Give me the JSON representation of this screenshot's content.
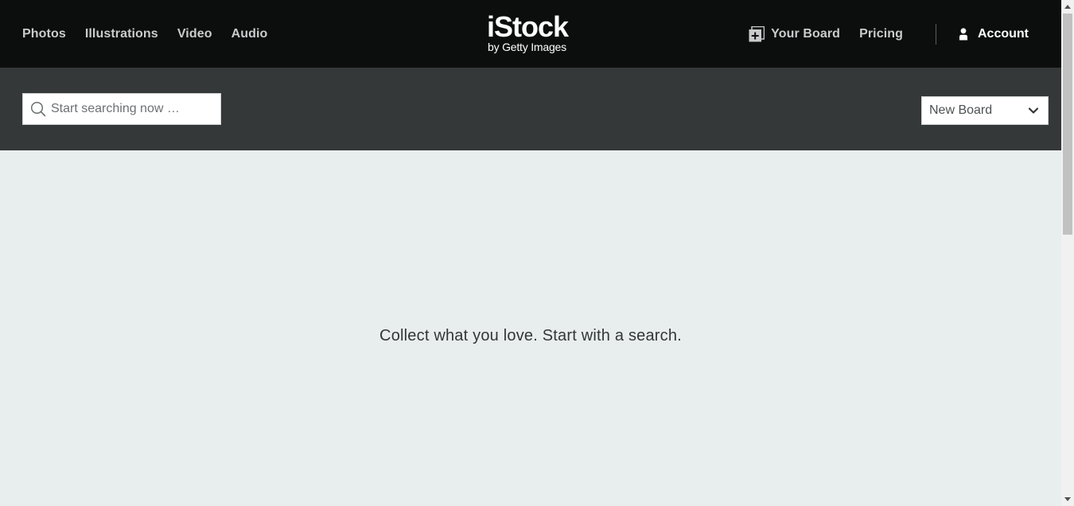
{
  "header": {
    "nav_left": [
      {
        "label": "Photos"
      },
      {
        "label": "Illustrations"
      },
      {
        "label": "Video"
      },
      {
        "label": "Audio"
      }
    ],
    "logo": {
      "main": "iStock",
      "sub": "by Getty Images"
    },
    "your_board_label": "Your Board",
    "your_board_icon": "board-add-icon",
    "pricing_label": "Pricing",
    "account_label": "Account",
    "account_icon": "person-icon"
  },
  "toolbar": {
    "search": {
      "placeholder": "Start searching now …",
      "value": "",
      "icon": "search-icon"
    },
    "board_select": {
      "selected": "New Board",
      "icon": "chevron-down-icon"
    }
  },
  "main": {
    "empty_message": "Collect what you love. Start with a search."
  },
  "colors": {
    "header_bg": "#0c0d0d",
    "toolbar_bg": "#353839",
    "content_bg": "#e8eeed",
    "nav_text": "#c9cccc",
    "accent_white": "#ffffff"
  }
}
